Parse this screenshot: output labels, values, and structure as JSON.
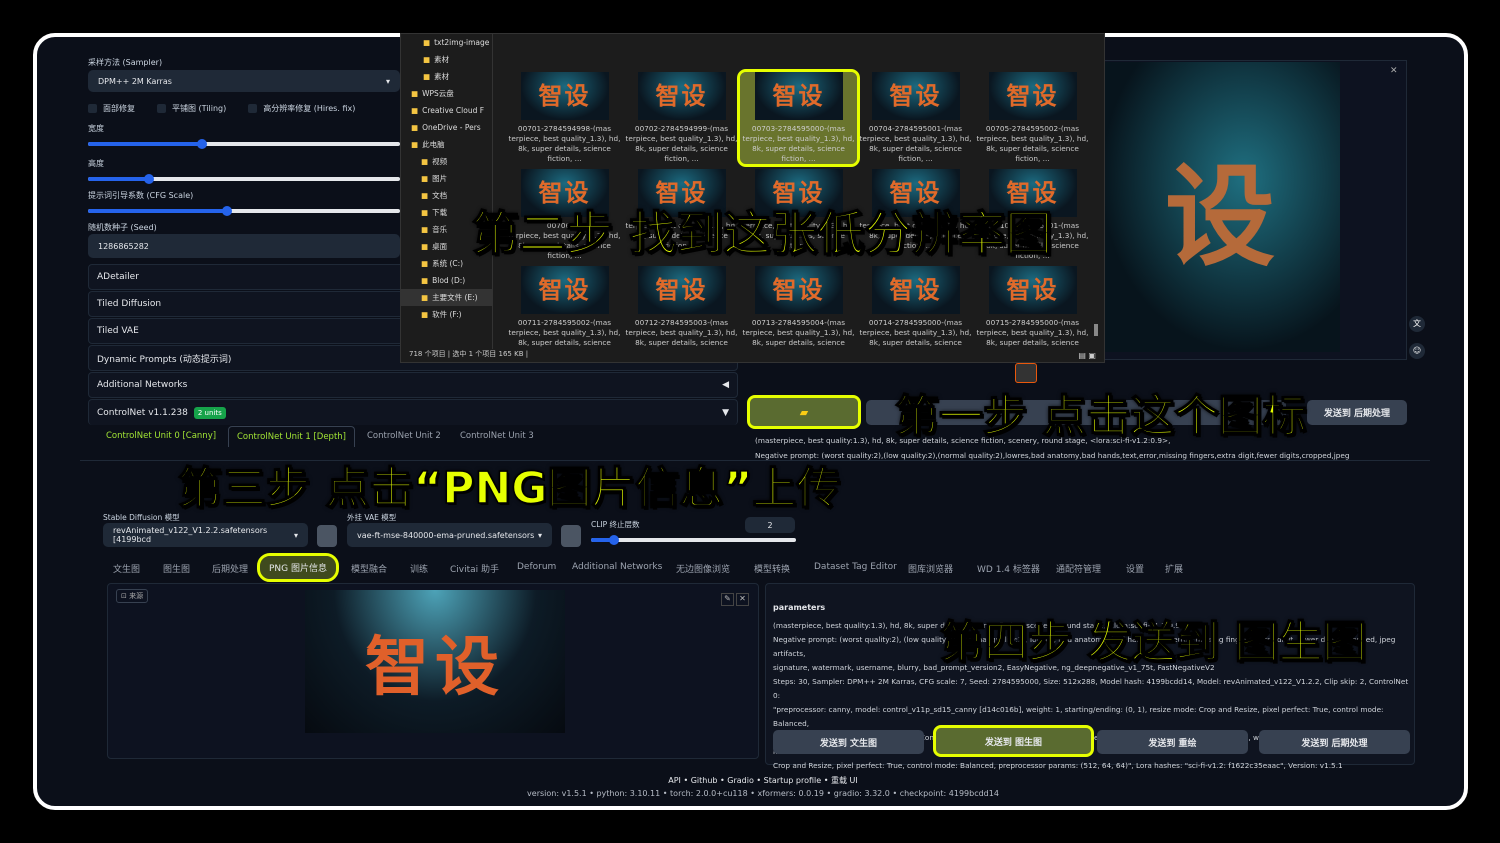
{
  "settings": {
    "sampler_label": "采样方法 (Sampler)",
    "sampler_value": "DPM++ 2M Karras",
    "checkboxes": [
      "面部修复",
      "平铺图 (Tiling)",
      "高分辨率修复 (Hires. fix)"
    ],
    "width_label": "宽度",
    "height_label": "高度",
    "cfg_label": "提示词引导系数 (CFG Scale)",
    "seed_label": "随机数种子 (Seed)",
    "seed_value": "1286865282",
    "width_fraction": 0.36,
    "height_fraction": 0.19,
    "cfg_fraction": 0.44
  },
  "accordions": [
    "ADetailer",
    "Tiled Diffusion",
    "Tiled VAE",
    "Dynamic Prompts (动态提示词)",
    "Additional Networks"
  ],
  "controlnet": {
    "title": "ControlNet v1.1.238",
    "badge": "2 units",
    "tabs": [
      "ControlNet Unit 0 [Canny]",
      "ControlNet Unit 1 [Depth]",
      "ControlNet Unit 2",
      "ControlNet Unit 3"
    ]
  },
  "explorer": {
    "tree": [
      "txt2img-image",
      "素材",
      "素材",
      "WPS云盘",
      "Creative Cloud F",
      "OneDrive - Pers",
      "此电脑",
      "视频",
      "图片",
      "文档",
      "下载",
      "音乐",
      "桌面",
      "系统 (C:)",
      "Blod (D:)",
      "主要文件 (E:)",
      "软件 (F:)"
    ],
    "status": "718 个项目  |  选中 1 个项目  165 KB  |",
    "thumb_text": "智设",
    "files": [
      "00701-2784594998-(mas",
      "00702-2784594999-(mas",
      "00703-2784595000-(mas",
      "00704-2784595001-(mas",
      "00705-2784595002-(mas",
      "00706-27",
      "",
      "",
      "",
      "00710-2784595001-(mas",
      "00711-2784595002-(mas",
      "00712-2784595003-(mas",
      "00713-2784595004-(mas",
      "00714-2784595000-(mas",
      "00715-2784595000-(mas"
    ],
    "file_desc": "terpiece, best quality_1.3), hd, 8k, super details, science fiction, ..."
  },
  "txt2img_buttons": {
    "send_extras": "发送到 后期处理"
  },
  "prompt_preview": {
    "positive": "(masterpiece, best quality:1.3), hd, 8k, super details, science fiction, scenery, round stage, <lora:sci-fi-v1.2:0.9>,",
    "negative": "Negative prompt: (worst quality:2),(low quality:2),(normal quality:2),lowres,bad anatomy,bad hands,text,error,missing fingers,extra digit,fewer digits,cropped,jpeg"
  },
  "models": {
    "sd_label": "Stable Diffusion 模型",
    "sd_value": "revAnimated_v122_V1.2.2.safetensors [4199bcd",
    "vae_label": "外挂 VAE 模型",
    "vae_value": "vae-ft-mse-840000-ema-pruned.safetensors",
    "clip_label": "CLIP 终止层数",
    "clip_value": "2"
  },
  "main_tabs": [
    "文生图",
    "图生图",
    "后期处理",
    "PNG 图片信息",
    "模型融合",
    "训练",
    "Civitai 助手",
    "Deforum",
    "Additional Networks",
    "无边图像浏览",
    "模型转换",
    "Dataset Tag Editor",
    "图库浏览器",
    "WD 1.4 标签器",
    "通配符管理",
    "设置",
    "扩展"
  ],
  "png_info": {
    "source_label": "来源",
    "image_text": "智设",
    "params_title": "parameters",
    "params": [
      "(masterpiece, best quality:1.3), hd, 8k, super details, science fiction, scenery, round stage, <lora:sci-fi-v1.2:0.9>,",
      "Negative prompt: (worst quality:2), (low quality:2), (normal quality:2), lowres, bad anatomy, bad hands, text, error, missing fingers, extra digit, fewer digits, cropped, jpeg artifacts,",
      "signature, watermark, username, blurry, bad_prompt_version2, EasyNegative, ng_deepnegative_v1_75t, FastNegativeV2",
      "Steps: 30, Sampler: DPM++ 2M Karras, CFG scale: 7, Seed: 2784595000, Size: 512x288, Model hash: 4199bcdd14, Model: revAnimated_v122_V1.2.2, Clip skip: 2, ControlNet 0:",
      "\"preprocessor: canny, model: control_v11p_sd15_canny [d14c016b], weight: 1, starting/ending: (0, 1), resize mode: Crop and Resize, pixel perfect: True, control mode: Balanced,",
      "preprocessor params: (512, 100, 200)\", ControlNet 1: \"preprocessor: depth_midas, model: control_v11f1p_sd15_depth [cfd03158], weight: 0.8, starting/ending: (0, 1), resize mode:",
      "Crop and Resize, pixel perfect: True, control mode: Balanced, preprocessor params: (512, 64, 64)\", Lora hashes: \"sci-fi-v1.2: f1622c35eaac\", Version: v1.5.1"
    ],
    "buttons": [
      "发送到 文生图",
      "发送到 图生图",
      "发送到 重绘",
      "发送到 后期处理"
    ]
  },
  "footer": {
    "links": "API  •  Github  •  Gradio  •  Startup profile  •  重载 UI",
    "versions": "version: v1.5.1  •  python: 3.10.11  •  torch: 2.0.0+cu118  •  xformers: 0.0.19  •  gradio: 3.32.0  •  checkpoint: 4199bcdd14"
  },
  "captions": {
    "step1": "第一步 点击这个图标",
    "step2": "第二步 找到这张低分辨率图",
    "step3": "第三步 点击“PNG图片信息”上传",
    "step4": "第四步 发送到 图生图"
  },
  "colors": {
    "caption": "#e6ff00",
    "accent": "#2563eb",
    "background": "#0b0f19"
  }
}
